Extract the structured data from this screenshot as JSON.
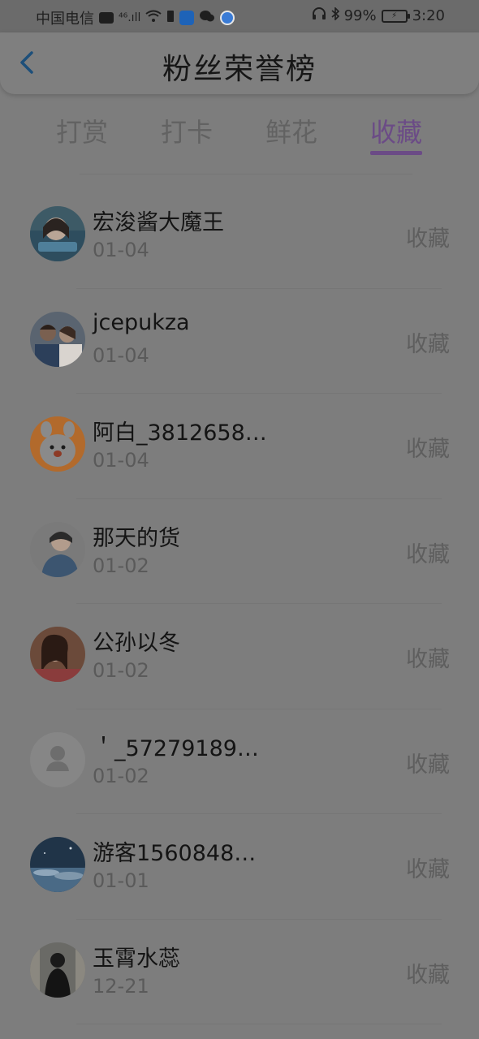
{
  "status_bar": {
    "carrier": "中国电信",
    "hd_badge": "HD",
    "signal_label": "⁴⁶.ıll",
    "battery_percent": "99%",
    "time": "3:20"
  },
  "header": {
    "title": "粉丝荣誉榜",
    "back_icon": "chevron-left-icon"
  },
  "tabs": [
    {
      "label": "打赏",
      "active": false
    },
    {
      "label": "打卡",
      "active": false
    },
    {
      "label": "鲜花",
      "active": false
    },
    {
      "label": "收藏",
      "active": true
    }
  ],
  "colors": {
    "accent": "#6b4b86",
    "overlay_bg": "#7d7d7d"
  },
  "fans": [
    {
      "name": "宏浚酱大魔王",
      "date": "01-04",
      "action": "收藏",
      "avatar": "photo-girl-blue"
    },
    {
      "name": "jcepukza",
      "date": "01-04",
      "action": "收藏",
      "avatar": "photo-couple"
    },
    {
      "name": "阿白_3812658…",
      "date": "01-04",
      "action": "收藏",
      "avatar": "cartoon-orange"
    },
    {
      "name": "那天的货",
      "date": "01-02",
      "action": "收藏",
      "avatar": "photo-boy-blue"
    },
    {
      "name": "公孙以冬",
      "date": "01-02",
      "action": "收藏",
      "avatar": "photo-girl-brown"
    },
    {
      "name": "＇_57279189…",
      "date": "01-02",
      "action": "收藏",
      "avatar": "default-user"
    },
    {
      "name": "游客1560848…",
      "date": "01-01",
      "action": "收藏",
      "avatar": "photo-sky"
    },
    {
      "name": "玉霄水蕊",
      "date": "12-21",
      "action": "收藏",
      "avatar": "photo-dark-figure"
    }
  ]
}
